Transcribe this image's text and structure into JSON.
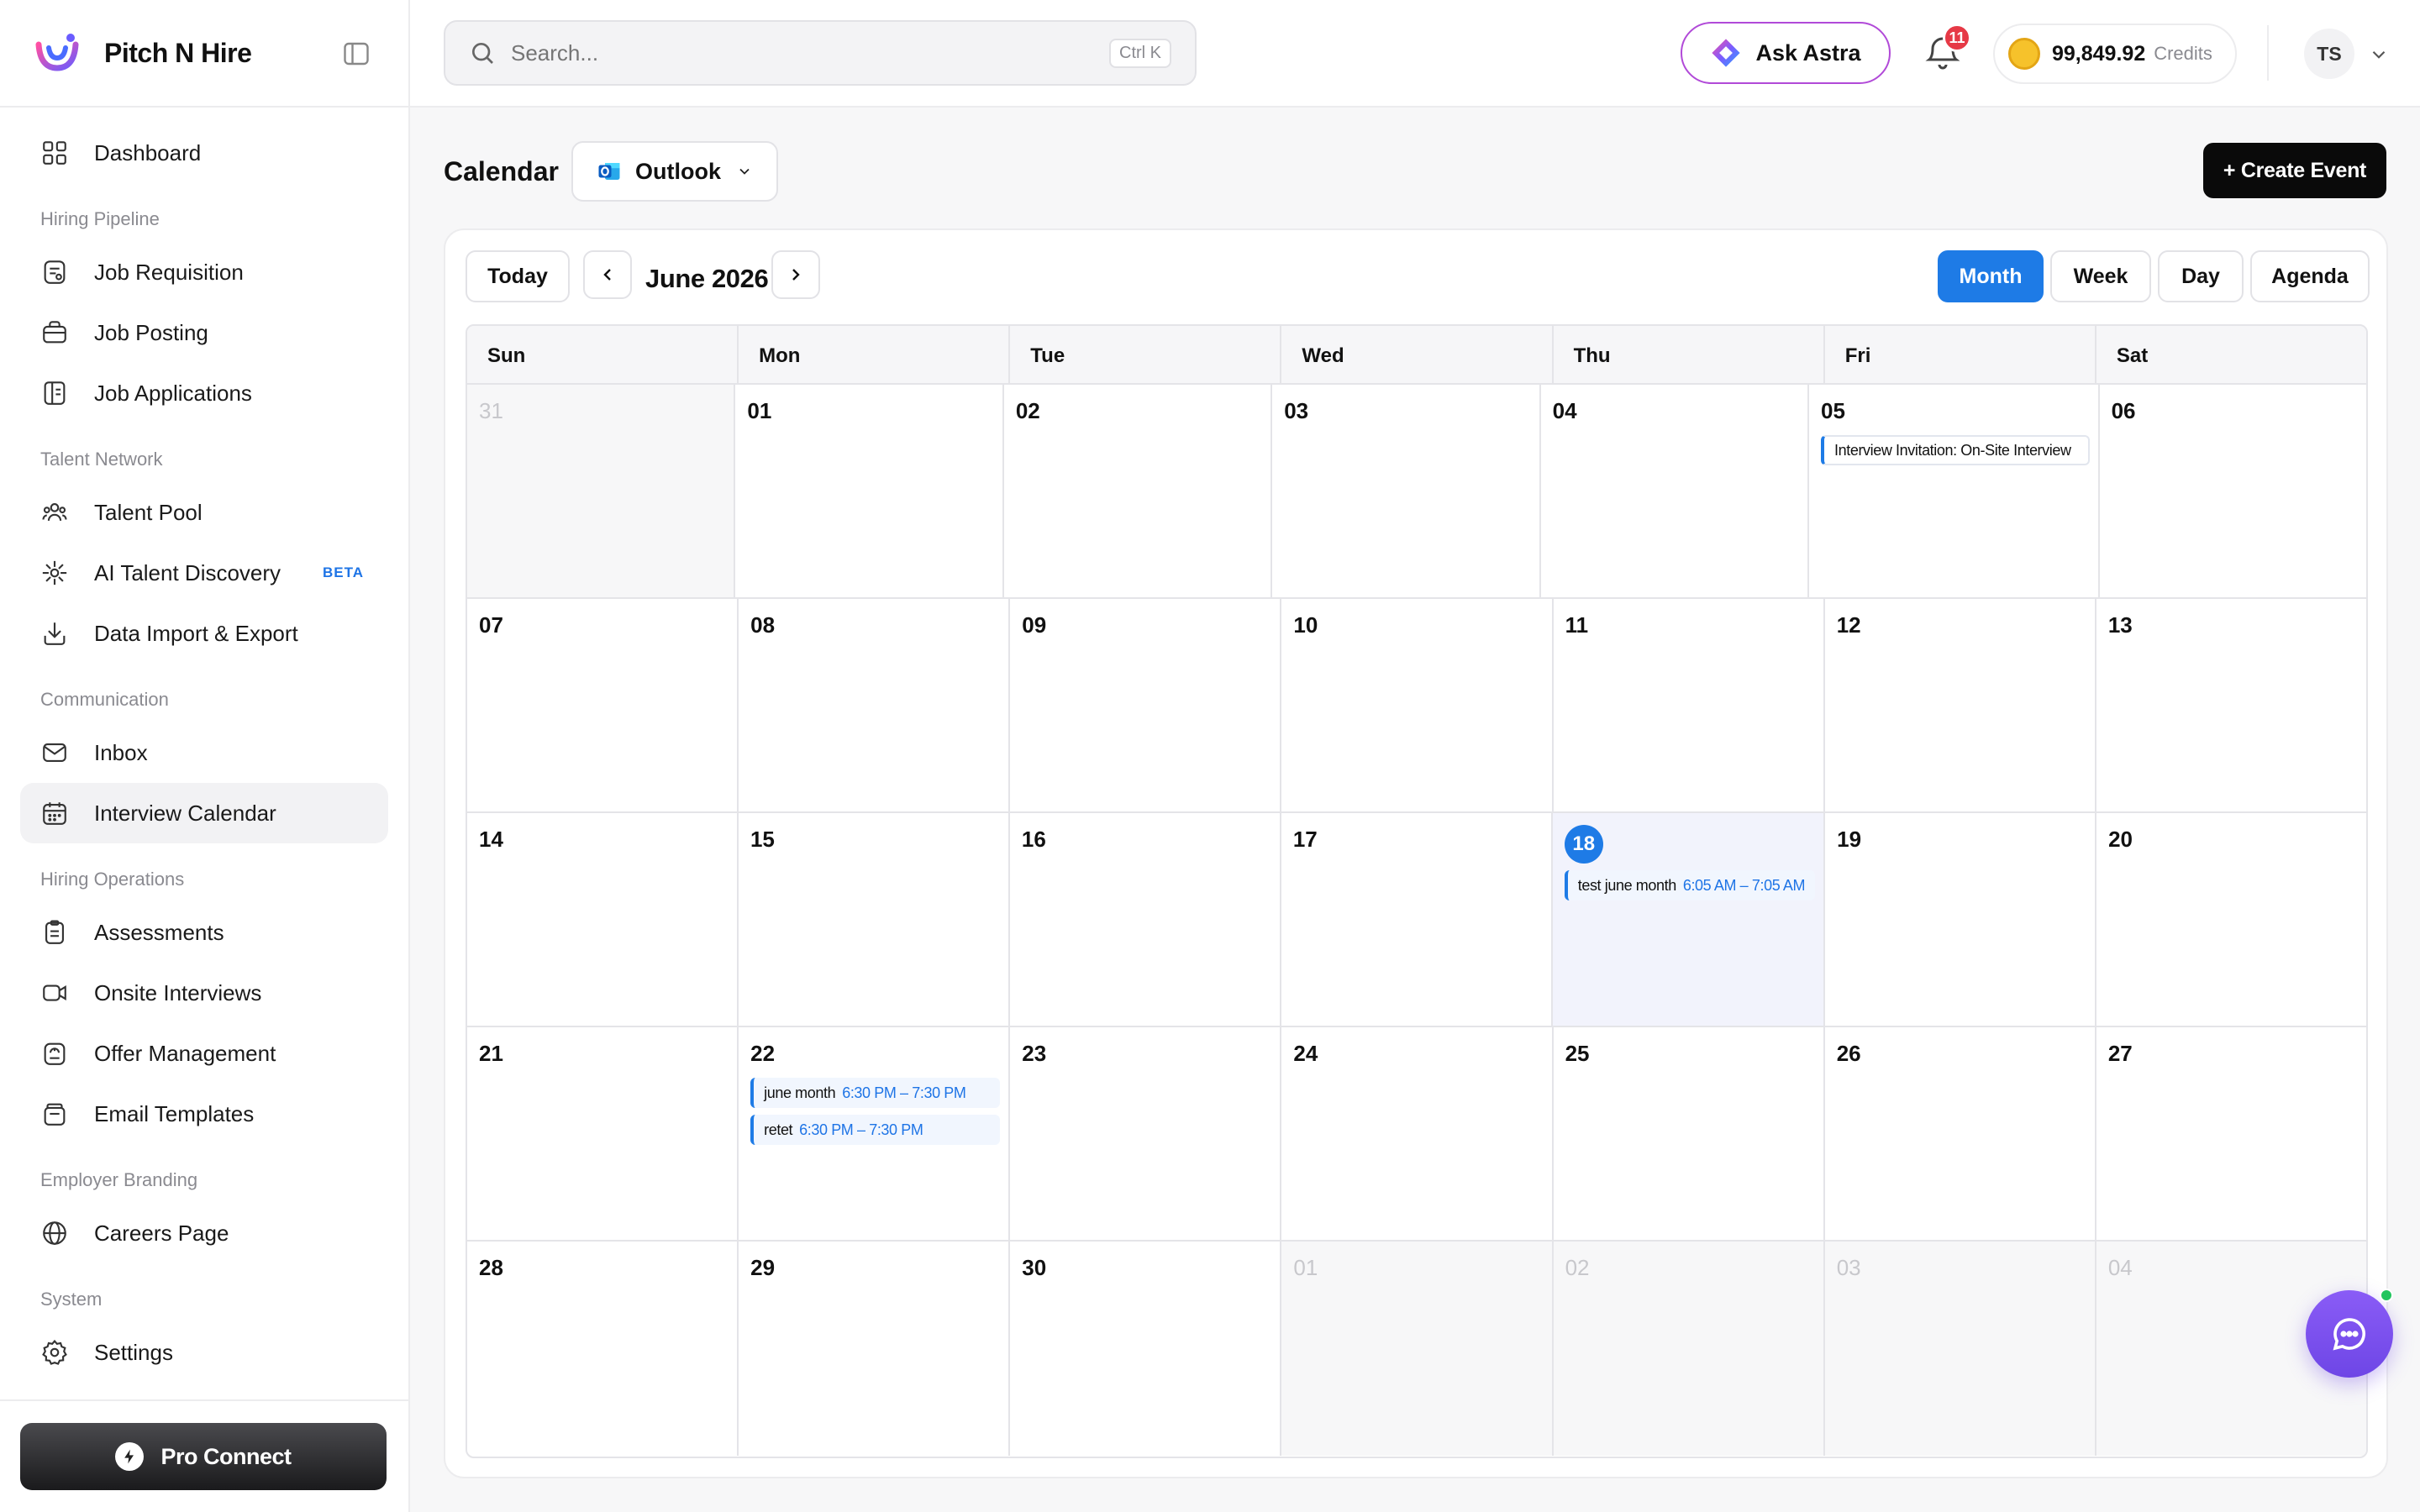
{
  "brand": {
    "name": "Pitch N Hire"
  },
  "sidebar": {
    "top_item": {
      "label": "Dashboard",
      "icon": "dashboard-icon"
    },
    "sections": [
      {
        "title": "Hiring Pipeline",
        "items": [
          {
            "label": "Job Requisition",
            "icon": "requisition-icon"
          },
          {
            "label": "Job Posting",
            "icon": "briefcase-icon"
          },
          {
            "label": "Job Applications",
            "icon": "applications-icon"
          }
        ]
      },
      {
        "title": "Talent Network",
        "items": [
          {
            "label": "Talent Pool",
            "icon": "users-icon"
          },
          {
            "label": "AI Talent Discovery",
            "icon": "ai-spark-icon",
            "badge": "BETA"
          },
          {
            "label": "Data Import & Export",
            "icon": "download-icon"
          }
        ]
      },
      {
        "title": "Communication",
        "items": [
          {
            "label": "Inbox",
            "icon": "mail-icon"
          },
          {
            "label": "Interview Calendar",
            "icon": "calendar-icon",
            "active": true
          }
        ]
      },
      {
        "title": "Hiring Operations",
        "items": [
          {
            "label": "Assessments",
            "icon": "clipboard-icon"
          },
          {
            "label": "Onsite Interviews",
            "icon": "video-icon"
          },
          {
            "label": "Offer Management",
            "icon": "offer-icon"
          },
          {
            "label": "Email Templates",
            "icon": "template-icon"
          }
        ]
      },
      {
        "title": "Employer Branding",
        "items": [
          {
            "label": "Careers Page",
            "icon": "globe-icon"
          }
        ]
      },
      {
        "title": "System",
        "items": [
          {
            "label": "Settings",
            "icon": "gear-icon"
          }
        ]
      }
    ],
    "pro_connect_label": "Pro Connect"
  },
  "topbar": {
    "search_placeholder": "Search...",
    "search_shortcut": "Ctrl K",
    "ask_astra_label": "Ask Astra",
    "notification_count": "11",
    "credits_amount": "99,849.92",
    "credits_label": "Credits",
    "user_initials": "TS"
  },
  "header": {
    "title": "Calendar",
    "source": "Outlook",
    "create_event_label": "+ Create Event"
  },
  "calendar": {
    "today_label": "Today",
    "month_label": "June 2026",
    "views": [
      "Month",
      "Week",
      "Day",
      "Agenda"
    ],
    "active_view": "Month",
    "weekdays": [
      "Sun",
      "Mon",
      "Tue",
      "Wed",
      "Thu",
      "Fri",
      "Sat"
    ],
    "weeks": [
      [
        {
          "num": "31",
          "other": true
        },
        {
          "num": "01"
        },
        {
          "num": "02"
        },
        {
          "num": "03"
        },
        {
          "num": "04"
        },
        {
          "num": "05",
          "events": [
            {
              "title": "Interview Invitation: On-Site Interview",
              "time": "",
              "style": "plain"
            }
          ]
        },
        {
          "num": "06"
        }
      ],
      [
        {
          "num": "07"
        },
        {
          "num": "08"
        },
        {
          "num": "09"
        },
        {
          "num": "10"
        },
        {
          "num": "11"
        },
        {
          "num": "12"
        },
        {
          "num": "13"
        }
      ],
      [
        {
          "num": "14"
        },
        {
          "num": "15"
        },
        {
          "num": "16"
        },
        {
          "num": "17"
        },
        {
          "num": "18",
          "today": true,
          "events": [
            {
              "title": "test june month",
              "time": "6:05 AM – 7:05 AM"
            }
          ]
        },
        {
          "num": "19"
        },
        {
          "num": "20"
        }
      ],
      [
        {
          "num": "21"
        },
        {
          "num": "22",
          "events": [
            {
              "title": "june month",
              "time": "6:30 PM – 7:30 PM"
            },
            {
              "title": "retet",
              "time": "6:30 PM – 7:30 PM"
            }
          ]
        },
        {
          "num": "23"
        },
        {
          "num": "24"
        },
        {
          "num": "25"
        },
        {
          "num": "26"
        },
        {
          "num": "27"
        }
      ],
      [
        {
          "num": "28"
        },
        {
          "num": "29"
        },
        {
          "num": "30"
        },
        {
          "num": "01",
          "other": true
        },
        {
          "num": "02",
          "other": true
        },
        {
          "num": "03",
          "other": true
        },
        {
          "num": "04",
          "other": true
        }
      ]
    ]
  },
  "colors": {
    "accent": "#1e7be6",
    "astra_border": "#b14ad8",
    "chat_fab": "#7c52f0",
    "badge": "#e63946"
  }
}
